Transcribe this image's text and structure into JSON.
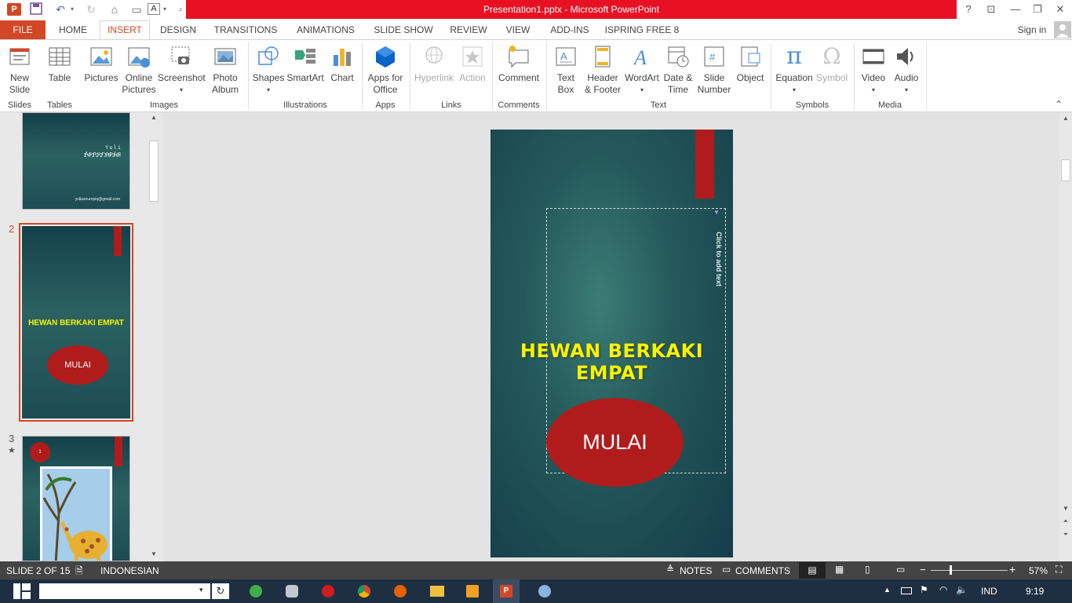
{
  "window": {
    "title": "Presentation1.pptx -  Microsoft PowerPoint",
    "help": "?",
    "sign_in": "Sign in"
  },
  "tabs": [
    "FILE",
    "HOME",
    "INSERT",
    "DESIGN",
    "TRANSITIONS",
    "ANIMATIONS",
    "SLIDE SHOW",
    "REVIEW",
    "VIEW",
    "ADD-INS",
    "ISPRING FREE 8"
  ],
  "ribbon": {
    "new_slide": "New\nSlide",
    "table": "Table",
    "pictures": "Pictures",
    "online_pictures": "Online\nPictures",
    "screenshot": "Screenshot",
    "photo_album": "Photo\nAlbum",
    "shapes": "Shapes",
    "smartart": "SmartArt",
    "chart": "Chart",
    "apps_for_office": "Apps for\nOffice",
    "hyperlink": "Hyperlink",
    "action": "Action",
    "comment": "Comment",
    "text_box": "Text\nBox",
    "header_footer": "Header\n& Footer",
    "wordart": "WordArt",
    "date_time": "Date &\nTime",
    "slide_number": "Slide\nNumber",
    "object": "Object",
    "equation": "Equation",
    "symbol": "Symbol",
    "video": "Video",
    "audio": "Audio",
    "groups": {
      "slides": "Slides",
      "tables": "Tables",
      "images": "Images",
      "illustrations": "Illustrations",
      "apps": "Apps",
      "links": "Links",
      "comments": "Comments",
      "text": "Text",
      "symbols": "Symbols",
      "media": "Media"
    }
  },
  "thumbnails": {
    "t1_author": "Yuli Asnuropiq",
    "t1_id": "141223030",
    "t1_email": "yuliasnuropiq@gmail.com",
    "t2_number": "2",
    "t2_title": "HEWAN BERKAKI EMPAT",
    "t2_button": "MULAI",
    "t3_number": "3",
    "t3_star": "★",
    "t3_badge": "1"
  },
  "slide": {
    "title": "HEWAN BERKAKI EMPAT",
    "button": "MULAI",
    "placeholder": "Click to add text"
  },
  "status": {
    "slide": "SLIDE 2 OF 15",
    "language": "INDONESIAN",
    "notes": "NOTES",
    "comments": "COMMENTS",
    "zoom": "57%"
  },
  "taskbar": {
    "language": "IND",
    "time": "9:19"
  },
  "colors": {
    "accent_red": "#e81123",
    "file_tab": "#d24726",
    "slide_title": "#f5f500",
    "slide_button": "#b01c1c"
  }
}
